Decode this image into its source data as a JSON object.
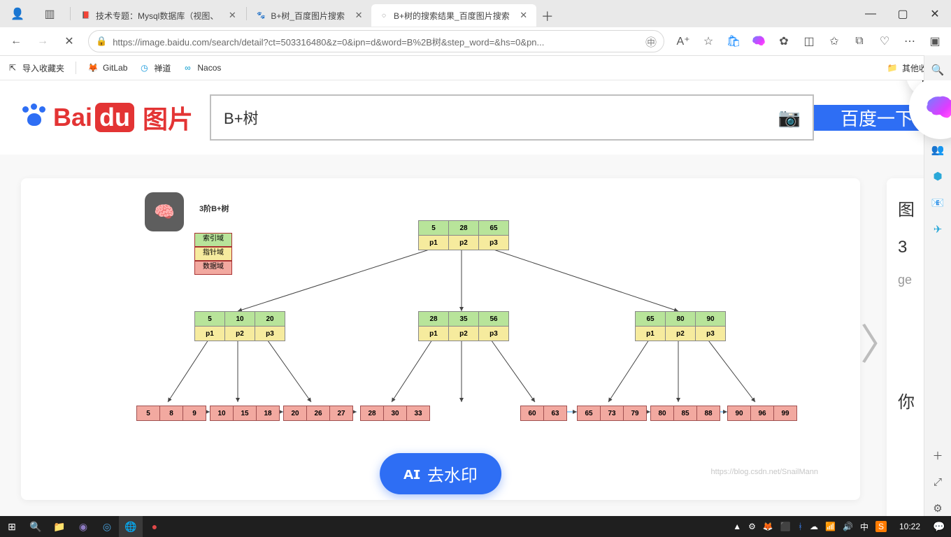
{
  "tabs": [
    {
      "label": "技术专题：Mysql数据库（视图、",
      "fav": "📕",
      "favbg": "#c33"
    },
    {
      "label": "B+树_百度图片搜索",
      "fav": "🐾",
      "favbg": "#2e6ef4"
    },
    {
      "label": "B+树的搜索结果_百度图片搜索",
      "fav": "◌",
      "favbg": "#fff"
    }
  ],
  "addr": {
    "url": "https://image.baidu.com/search/detail?ct=503316480&z=0&ipn=d&word=B%2B树&step_word=&hs=0&pn..."
  },
  "bookmarks": {
    "import": "导入收藏夹",
    "items": [
      {
        "label": "GitLab",
        "icon": "🦊",
        "color": "#fc6d26"
      },
      {
        "label": "禅道",
        "icon": "◷",
        "color": "#1296db"
      },
      {
        "label": "Nacos",
        "icon": "∞",
        "color": "#09c"
      }
    ],
    "other": "其他收藏夹"
  },
  "search": {
    "value": "B+树",
    "button": "百度一下",
    "placeholder": ""
  },
  "rightPanel": {
    "l1": "图",
    "l2": "3",
    "l3": "ge",
    "l4": "你"
  },
  "diagram": {
    "title": "3阶B+树",
    "legend": {
      "idx": "索引域",
      "ptr": "指针域",
      "dat": "数据域"
    },
    "root": {
      "keys": [
        "5",
        "28",
        "65"
      ],
      "ptrs": [
        "p1",
        "p2",
        "p3"
      ]
    },
    "mids": [
      {
        "keys": [
          "5",
          "10",
          "20"
        ],
        "ptrs": [
          "p1",
          "p2",
          "p3"
        ]
      },
      {
        "keys": [
          "28",
          "35",
          "56"
        ],
        "ptrs": [
          "p1",
          "p2",
          "p3"
        ]
      },
      {
        "keys": [
          "65",
          "80",
          "90"
        ],
        "ptrs": [
          "p1",
          "p2",
          "p3"
        ]
      }
    ],
    "leaves": [
      [
        "5",
        "8",
        "9"
      ],
      [
        "10",
        "15",
        "18"
      ],
      [
        "20",
        "26",
        "27"
      ],
      [
        "28",
        "30",
        "33"
      ],
      [
        "",
        "",
        ""
      ],
      [
        "60",
        "63"
      ],
      [
        "65",
        "73",
        "79"
      ],
      [
        "80",
        "85",
        "88"
      ],
      [
        "90",
        "96",
        "99"
      ]
    ],
    "watermark_btn": "去水印",
    "watermark_src": "https://blog.csdn.net/SnailMann"
  },
  "sidebar": {
    "icons": [
      "🔍",
      "🔖",
      "🛒",
      "👥",
      "⬢",
      "📧",
      "✈",
      "＋",
      "⤢",
      "⚙"
    ]
  },
  "taskbar": {
    "left": [
      "⊞",
      "🔍",
      "📁",
      "◉",
      "◎",
      "🌐",
      "●"
    ],
    "tray": [
      "▲",
      "⚙",
      "🦊",
      "⬛",
      "ᚼ",
      "☁",
      "📶",
      "🔊",
      "中",
      "S"
    ],
    "clock": "10:22"
  }
}
